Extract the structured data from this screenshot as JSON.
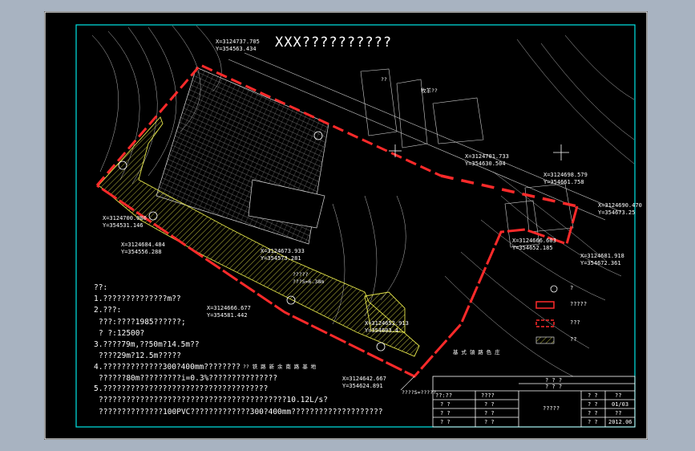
{
  "drawing": {
    "title": "XXX??????????",
    "labels": {
      "building_label": "??",
      "road_label": "牧羊??",
      "area_label": "???S=6.38m",
      "area_label_top": "?????",
      "bottom_road": "基 式 領 路 色 庄",
      "side_text": "?? 铁 路 新 余 南 路 基 地",
      "well_label": "????S=?????"
    },
    "coordinates": [
      {
        "x": "X=3124737.705",
        "y": "Y=354563.434"
      },
      {
        "x": "X=3124701.733",
        "y": "Y=354630.504"
      },
      {
        "x": "X=3124698.579",
        "y": "Y=354661.758"
      },
      {
        "x": "X=3124690.470",
        "y": "Y=354673.25"
      },
      {
        "x": "X=3124700.080",
        "y": "Y=354531.146"
      },
      {
        "x": "X=3124684.484",
        "y": "Y=354556.288"
      },
      {
        "x": "X=3124673.933",
        "y": "Y=354573.281"
      },
      {
        "x": "X=3124666.603",
        "y": "Y=354652.185"
      },
      {
        "x": "X=3124681.918",
        "y": "Y=354672.361"
      },
      {
        "x": "X=3124666.677",
        "y": "Y=354581.442"
      },
      {
        "x": "X=3124652.913",
        "y": "Y=354603.4"
      },
      {
        "x": "X=3124642.667",
        "y": "Y=354624.891"
      }
    ],
    "notes": [
      "??:",
      "1.??????????????m??",
      "2.???:",
      "???:????1985??????;",
      "?   ?:12500?",
      "3.????79m,??50m?14.5m??",
      "????29m?12.5m?????",
      "4.?????????????300?400mm????????",
      "??????80m?????????i=0.3%???????????????",
      "5.????????????????????????????????????",
      "?????????????????????????????????????????10.12L/s?",
      "??????????????100PVC?????????????300?400mm????????????????????"
    ],
    "legend": [
      {
        "symbol": "circle",
        "label": "?"
      },
      {
        "symbol": "red-box",
        "label": "?????"
      },
      {
        "symbol": "red-dash-box",
        "label": "???"
      },
      {
        "symbol": "hatch-box",
        "label": "??"
      }
    ],
    "title_block": {
      "header": "? ? ?",
      "sub_header": "? ? ?",
      "drawing_name": "?????",
      "left_rows": [
        "??:??",
        "? ?",
        "? ?",
        "? ?"
      ],
      "mid_rows": [
        "????",
        "? ?",
        "? ?",
        "? ?"
      ],
      "right_labels": [
        "? ?",
        "? ?",
        "? ?",
        "? ?"
      ],
      "right_values": [
        "??",
        "01/03",
        "??",
        "2012.06"
      ]
    },
    "colors": {
      "boundary": "#ff2a2a",
      "hatch": "#e6e64a",
      "frame": "#00e5e5",
      "lines": "#ffffff",
      "background": "#000000",
      "page": "#a8b3c1"
    }
  }
}
